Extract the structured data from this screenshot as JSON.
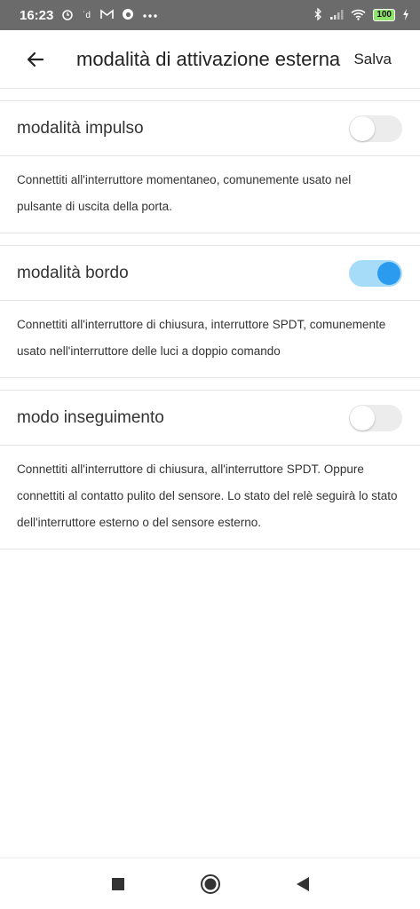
{
  "status_bar": {
    "time": "16:23",
    "battery": "100",
    "icons": [
      "alarm-icon",
      "notification-icon",
      "gmail-icon",
      "vodafone-icon",
      "more-icon",
      "bluetooth-icon",
      "signal-icon",
      "wifi-icon",
      "battery-icon",
      "charging-icon"
    ]
  },
  "header": {
    "back_icon": "arrow-left-icon",
    "title": "modalità di attivazione esterna",
    "save_label": "Salva"
  },
  "modes": [
    {
      "label": "modalità impulso",
      "enabled": false,
      "description": "Connettiti all'interruttore momentaneo, comunemente usato nel pulsante di uscita della porta."
    },
    {
      "label": "modalità bordo",
      "enabled": true,
      "description": "Connettiti all'interruttore di chiusura, interruttore SPDT, comunemente usato nell'interruttore delle luci a doppio comando"
    },
    {
      "label": "modo inseguimento",
      "enabled": false,
      "description": "Connettiti all'interruttore di chiusura, all'interruttore SPDT. Oppure connettiti al contatto pulito del sensore. Lo stato del relè seguirà lo stato dell'interruttore esterno o del sensore esterno."
    }
  ],
  "colors": {
    "status_bar_bg": "#6b6b6b",
    "toggle_on_track": "#a6dcf7",
    "toggle_on_knob": "#2a9bee",
    "toggle_off_track": "#ececec"
  },
  "nav_bar": {
    "icons": [
      "recents-square-icon",
      "home-circle-icon",
      "back-triangle-icon"
    ]
  }
}
